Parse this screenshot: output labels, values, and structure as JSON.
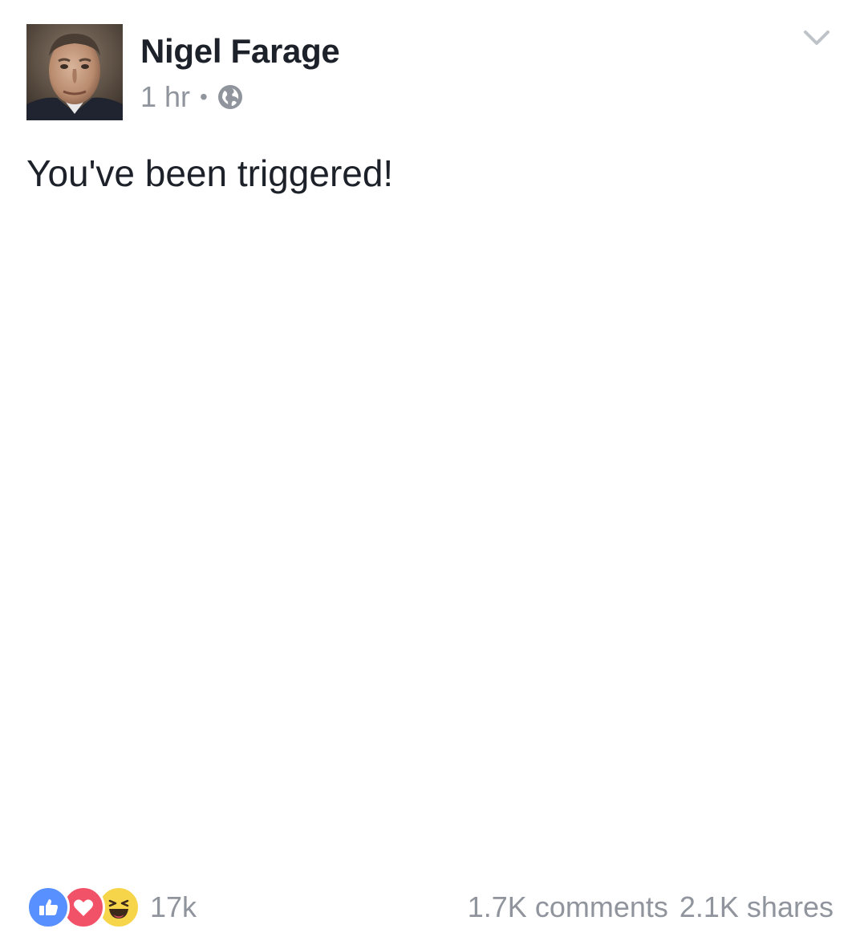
{
  "post": {
    "author": "Nigel Farage",
    "timestamp": "1 hr",
    "separator": "•",
    "privacy_icon": "globe-icon",
    "menu_icon": "chevron-down-icon",
    "text": "You've been triggered!"
  },
  "footer": {
    "reactions": [
      {
        "name": "like",
        "icon": "thumbs-up-icon",
        "color": "#5890ff"
      },
      {
        "name": "love",
        "icon": "heart-icon",
        "color": "#f25268"
      },
      {
        "name": "haha",
        "icon": "laughing-face-icon",
        "color": "#f7d54a"
      }
    ],
    "reaction_count": "17k",
    "comments": "1.7K comments",
    "shares": "2.1K shares"
  },
  "colors": {
    "text_primary": "#1d2129",
    "text_secondary": "#90949c",
    "background": "#ffffff"
  }
}
